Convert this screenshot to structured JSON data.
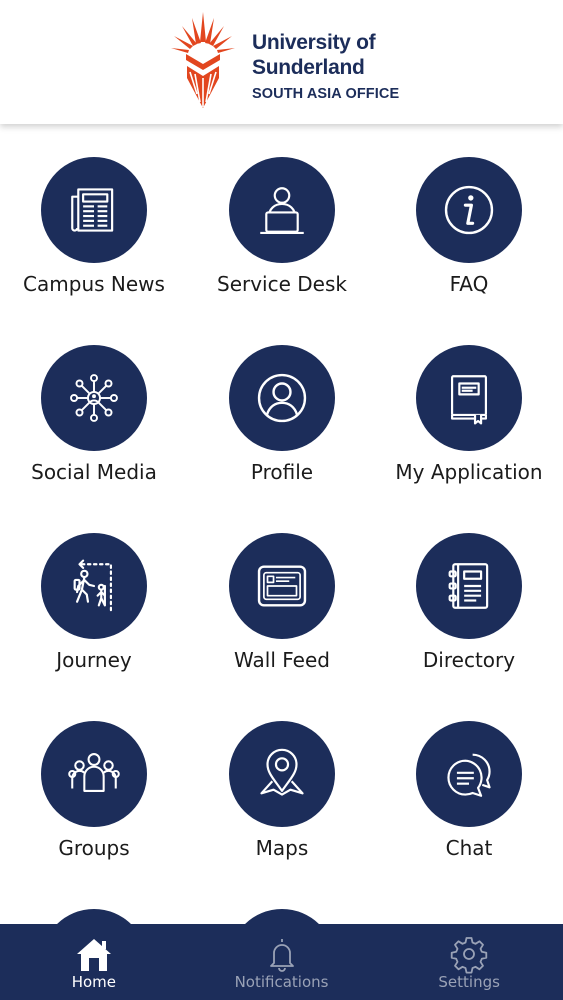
{
  "header": {
    "logo_line1": "University of",
    "logo_line2": "Sunderland",
    "logo_line3": "SOUTH ASIA OFFICE",
    "brand_color": "#1c2d5a",
    "accent_color": "#e2461f"
  },
  "tiles": [
    {
      "label": "Campus News",
      "icon": "newspaper-icon"
    },
    {
      "label": "Service Desk",
      "icon": "service-desk-icon"
    },
    {
      "label": "FAQ",
      "icon": "info-icon"
    },
    {
      "label": "Social Media",
      "icon": "social-network-icon"
    },
    {
      "label": "Profile",
      "icon": "user-profile-icon"
    },
    {
      "label": "My Application",
      "icon": "book-icon"
    },
    {
      "label": "Journey",
      "icon": "journey-icon"
    },
    {
      "label": "Wall Feed",
      "icon": "wall-feed-icon"
    },
    {
      "label": "Directory",
      "icon": "directory-icon"
    },
    {
      "label": "Groups",
      "icon": "groups-icon"
    },
    {
      "label": "Maps",
      "icon": "map-pin-icon"
    },
    {
      "label": "Chat",
      "icon": "chat-bubbles-icon"
    }
  ],
  "tabbar": {
    "tabs": [
      {
        "label": "Home",
        "icon": "home-icon",
        "active": true
      },
      {
        "label": "Notifications",
        "icon": "bell-icon",
        "active": false
      },
      {
        "label": "Settings",
        "icon": "gear-icon",
        "active": false
      }
    ]
  }
}
